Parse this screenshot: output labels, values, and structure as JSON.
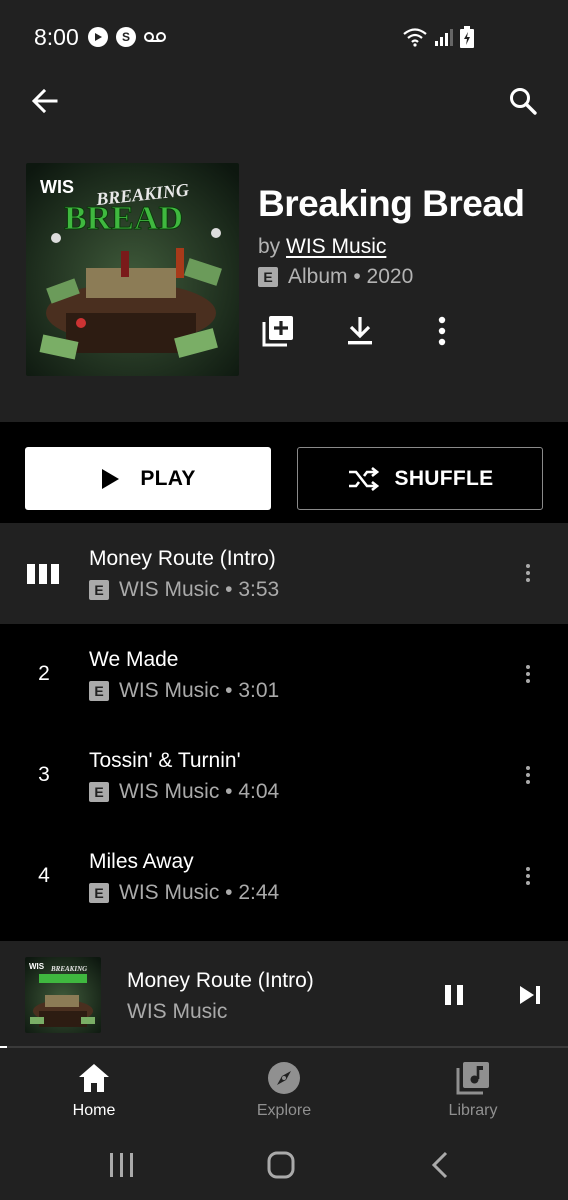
{
  "status_bar": {
    "time": "8:00",
    "left_icons": [
      "play-circle-icon",
      "s-circle-icon",
      "voicemail-icon"
    ],
    "right_icons": [
      "wifi-icon",
      "signal-icon",
      "battery-charging-icon"
    ]
  },
  "header": {
    "back_icon": "arrow-back-icon",
    "search_icon": "search-icon"
  },
  "album": {
    "art_text_brand": "WIS",
    "art_text_line1": "BREAKING",
    "art_text_line2": "BREAD",
    "title": "Breaking Bread",
    "by_prefix": "by",
    "artist": "WIS Music",
    "explicit_badge": "E",
    "meta": "Album • 2020",
    "actions": [
      "add-to-library-icon",
      "download-icon",
      "more-vert-icon"
    ]
  },
  "buttons": {
    "play_label": "PLAY",
    "shuffle_label": "SHUFFLE"
  },
  "tracks": [
    {
      "number": "",
      "title": "Money Route (Intro)",
      "explicit": "E",
      "subtitle": "WIS Music • 3:53",
      "playing": true
    },
    {
      "number": "2",
      "title": "We Made",
      "explicit": "E",
      "subtitle": "WIS Music • 3:01",
      "playing": false
    },
    {
      "number": "3",
      "title": "Tossin' & Turnin'",
      "explicit": "E",
      "subtitle": "WIS Music • 4:04",
      "playing": false
    },
    {
      "number": "4",
      "title": "Miles Away",
      "explicit": "E",
      "subtitle": "WIS Music • 2:44",
      "playing": false
    }
  ],
  "mini_player": {
    "art_text_brand": "WIS",
    "art_text_line1": "BREAKING",
    "title": "Money Route (Intro)",
    "artist": "WIS Music",
    "progress_fraction": 0.012
  },
  "nav": {
    "items": [
      {
        "label": "Home",
        "icon": "home-icon",
        "active": true
      },
      {
        "label": "Explore",
        "icon": "compass-icon",
        "active": false
      },
      {
        "label": "Library",
        "icon": "library-music-icon",
        "active": false
      }
    ]
  },
  "colors": {
    "surface": "#212121",
    "background": "#000000",
    "text_primary": "#ffffff",
    "text_secondary": "#aaaaaa",
    "nav_inactive": "#909090"
  }
}
